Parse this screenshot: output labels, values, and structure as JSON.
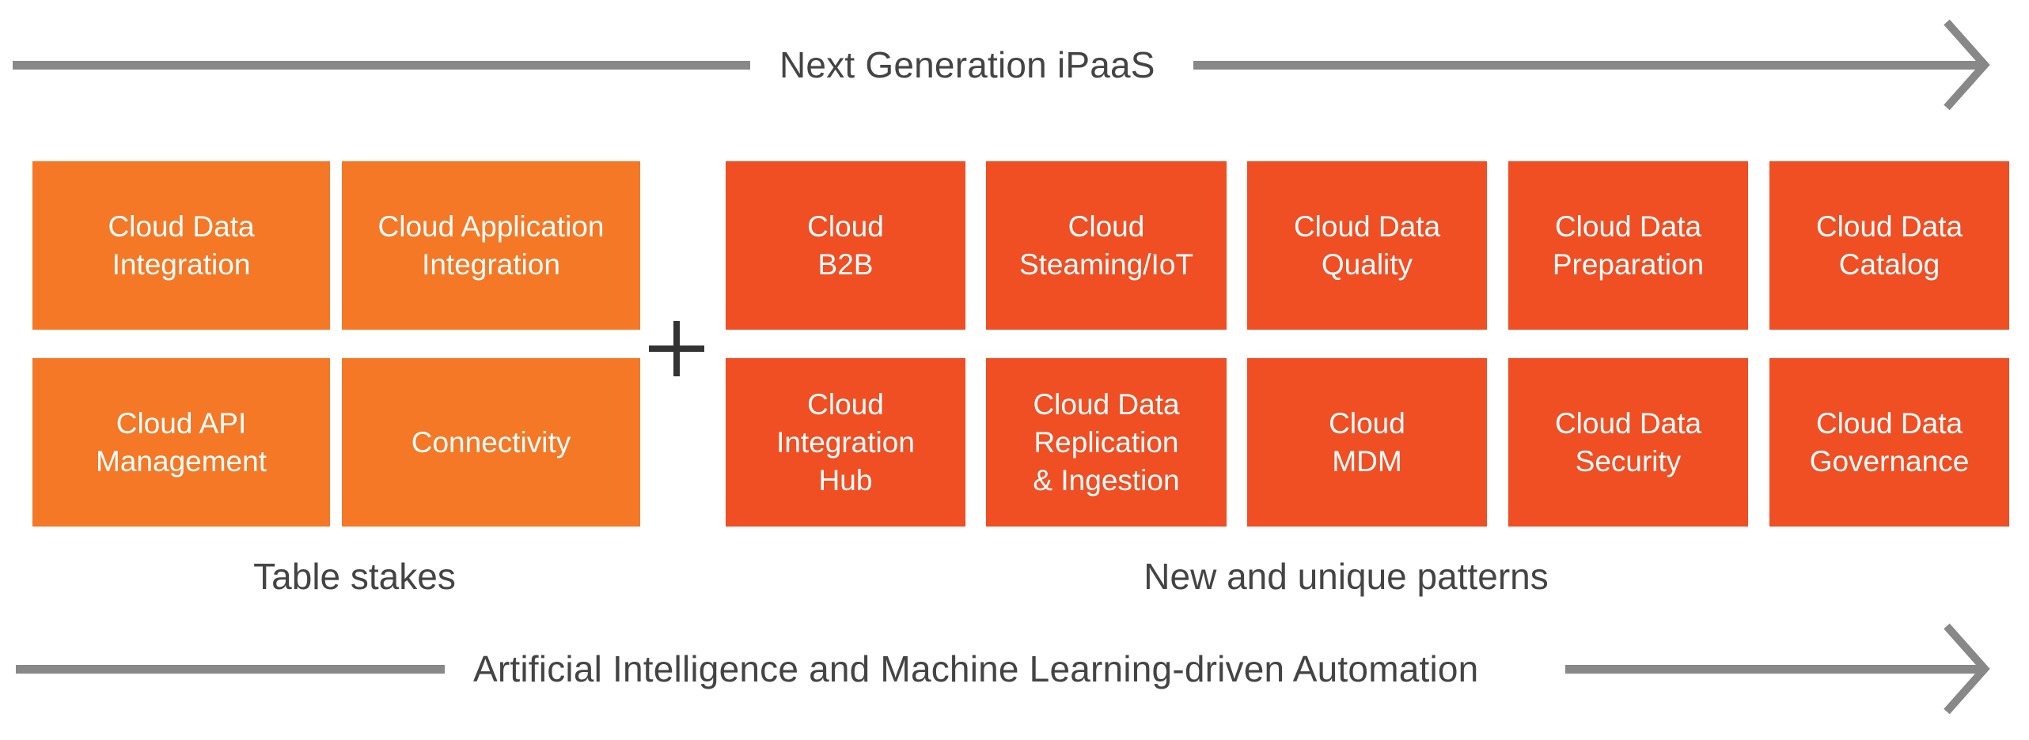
{
  "top_banner": {
    "label": "Next Generation iPaaS",
    "arrow_icon": "right-arrow-icon"
  },
  "bottom_banner": {
    "label": "Artificial Intelligence and Machine Learning-driven Automation",
    "arrow_icon": "right-arrow-icon"
  },
  "colors": {
    "table_stakes": "#f47825",
    "new_patterns": "#f04e23",
    "arrow": "#888888",
    "text": "#444444"
  },
  "connector": {
    "icon": "plus-icon"
  },
  "groups": {
    "table_stakes": {
      "label": "Table stakes",
      "items": [
        {
          "label": "Cloud Data\nIntegration"
        },
        {
          "label": "Cloud Application\nIntegration"
        },
        {
          "label": "Cloud API\nManagement"
        },
        {
          "label": "Connectivity"
        }
      ]
    },
    "new_patterns": {
      "label": "New and unique patterns",
      "items": [
        {
          "label": "Cloud\nB2B"
        },
        {
          "label": "Cloud\nSteaming/IoT"
        },
        {
          "label": "Cloud Data\nQuality"
        },
        {
          "label": "Cloud Data\nPreparation"
        },
        {
          "label": "Cloud Data\nCatalog"
        },
        {
          "label": "Cloud\nIntegration\nHub"
        },
        {
          "label": "Cloud Data\nReplication\n& Ingestion"
        },
        {
          "label": "Cloud\nMDM"
        },
        {
          "label": "Cloud Data\nSecurity"
        },
        {
          "label": "Cloud Data\nGovernance"
        }
      ]
    }
  }
}
